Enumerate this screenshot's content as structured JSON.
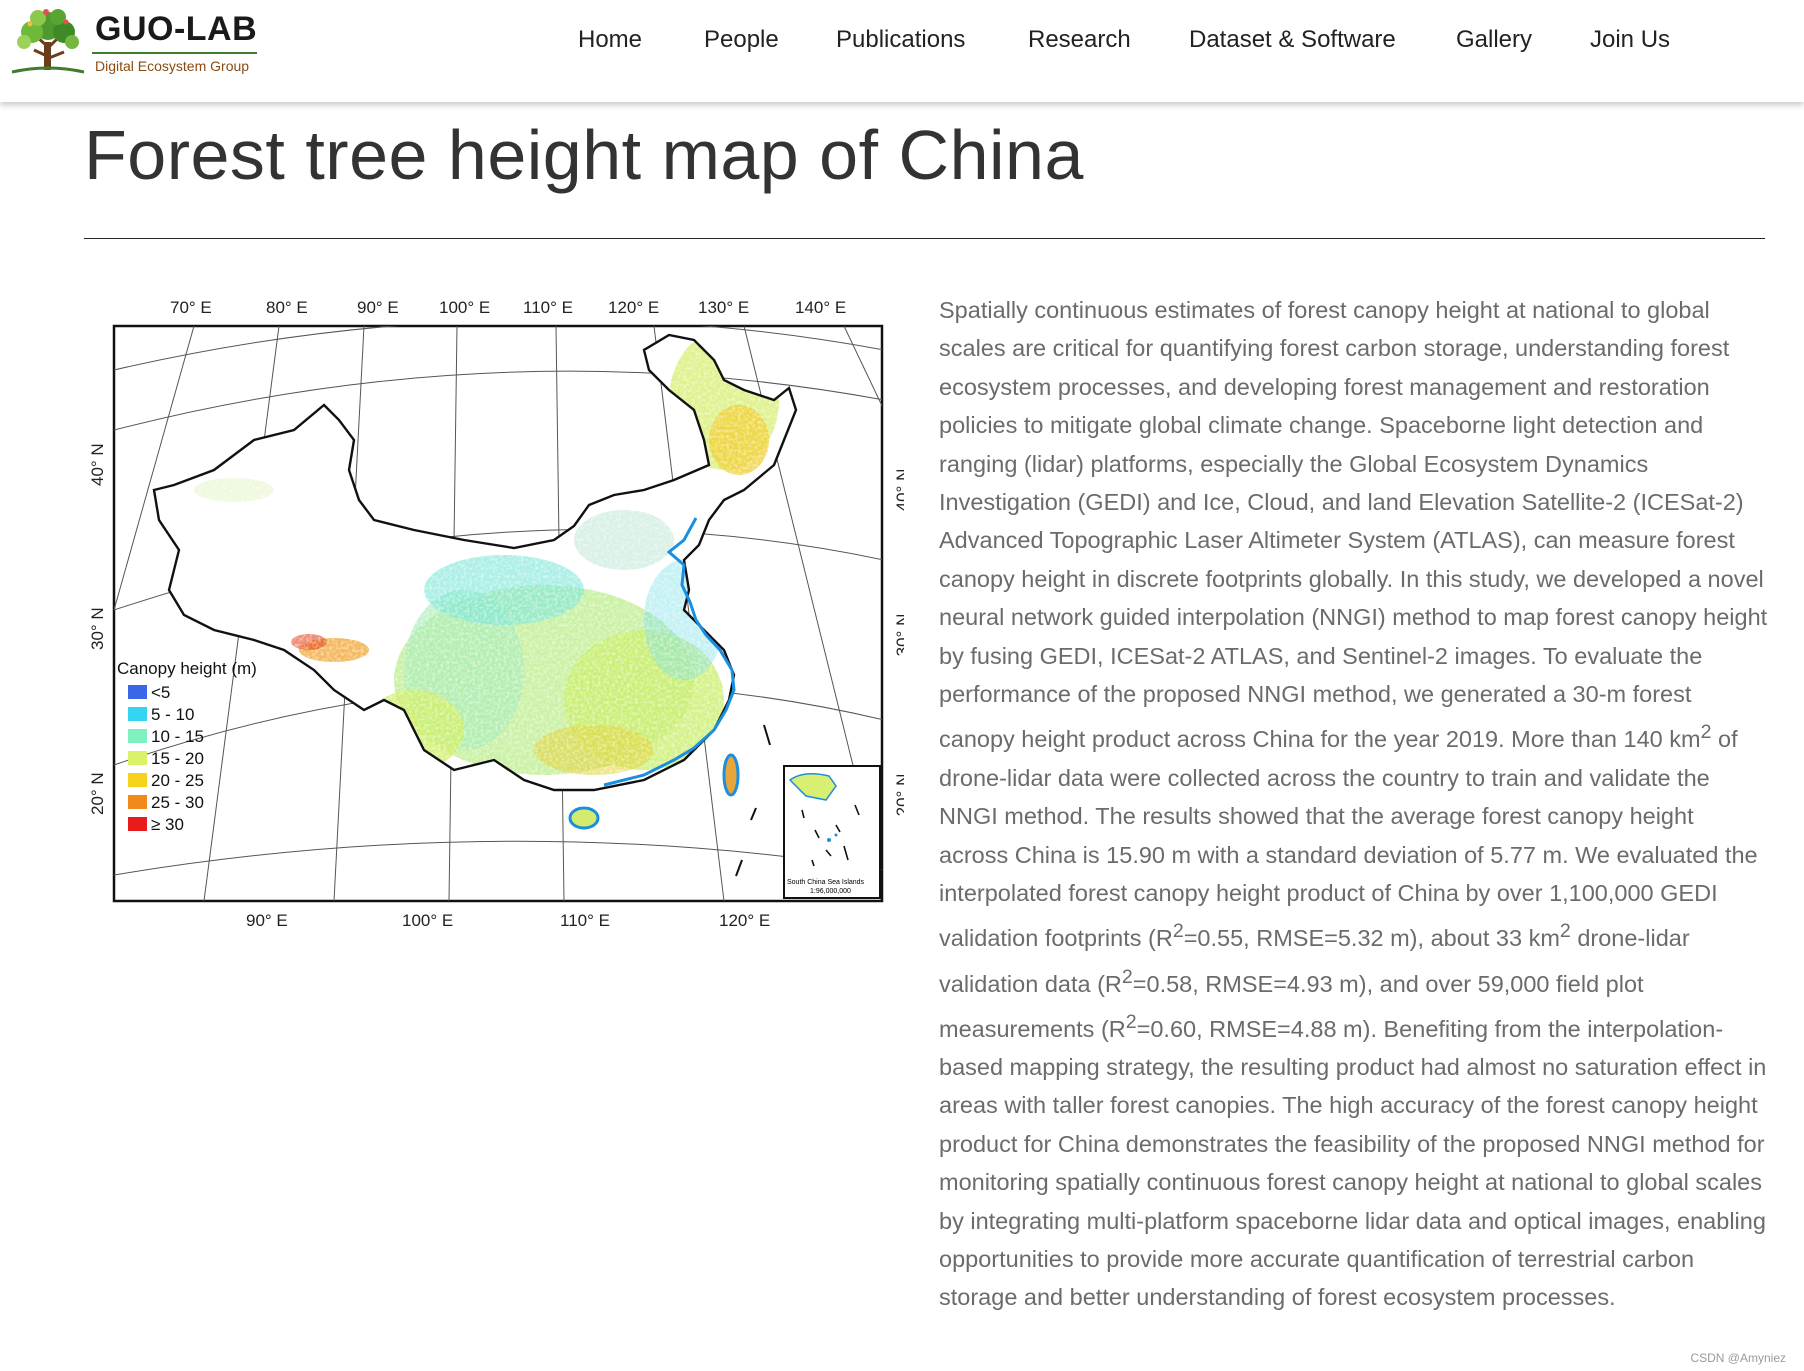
{
  "brand": {
    "name": "GUO-LAB",
    "subtitle": "Digital Ecosystem Group"
  },
  "nav": {
    "items": [
      "Home",
      "People",
      "Publications",
      "Research",
      "Dataset & Software",
      "Gallery",
      "Join Us"
    ]
  },
  "page": {
    "title": "Forest tree height map of China"
  },
  "map": {
    "top_lon_labels": [
      "70° E",
      "80° E",
      "90° E",
      "100° E",
      "110° E",
      "120° E",
      "130° E",
      "140° E"
    ],
    "bottom_lon_labels": [
      "90° E",
      "100° E",
      "110° E",
      "120° E"
    ],
    "lat_labels": [
      "40° N",
      "30° N",
      "20° N"
    ],
    "legend": {
      "title": "Canopy height (m)",
      "items": [
        {
          "label": "<5",
          "color": "#3a66e8"
        },
        {
          "label": "5 - 10",
          "color": "#35d4f2"
        },
        {
          "label": "10 - 15",
          "color": "#7ff0c0"
        },
        {
          "label": "15 - 20",
          "color": "#d8f36a"
        },
        {
          "label": "20 - 25",
          "color": "#f5d21c"
        },
        {
          "label": "25 - 30",
          "color": "#f08a1a"
        },
        {
          "label": "≥ 30",
          "color": "#e81c1c"
        }
      ]
    },
    "inset": {
      "title": "South China Sea Islands",
      "scale": "1:96,000,000"
    }
  },
  "abstract": {
    "p1": "Spatially continuous estimates of forest canopy height at national to global scales are critical for quantifying forest carbon storage, understanding forest ecosystem processes, and developing forest management and restoration policies to mitigate global climate change. Spaceborne light detection and ranging (lidar) platforms, especially the Global Ecosystem Dynamics Investigation (GEDI) and Ice, Cloud, and land Elevation Satellite-2 (ICESat-2) Advanced Topographic Laser Altimeter System (ATLAS), can measure forest canopy height in discrete footprints globally. In this study, we developed a novel neural network guided interpolation (NNGI) method to map forest canopy height by fusing GEDI, ICESat-2 ATLAS, and Sentinel-2 images. To evaluate the performance of the proposed NNGI method, we generated a 30-m forest canopy height product across China for the year 2019. More than 140 km",
    "sup1": "2",
    "p2": " of drone-lidar data were collected across the country to train and validate the NNGI method. The results showed that the average forest canopy height across China is 15.90 m with a standard deviation of 5.77 m. We evaluated the interpolated forest canopy height product of China by over 1,100,000 GEDI validation footprints (R",
    "sup2": "2",
    "p3": "=0.55, RMSE=5.32 m), about 33 km",
    "sup3": "2",
    "p4": " drone-lidar validation data (R",
    "sup4": "2",
    "p5": "=0.58, RMSE=4.93 m), and over 59,000 field plot measurements (R",
    "sup5": "2",
    "p6": "=0.60, RMSE=4.88 m). Benefiting from the interpolation-based mapping strategy, the resulting product had almost no saturation effect in areas with taller forest canopies. The high accuracy of the forest canopy height product for China demonstrates the feasibility of the proposed NNGI method for monitoring spatially continuous forest canopy height at national to global scales by integrating multi-platform spaceborne lidar data and optical images, enabling opportunities to provide more accurate quantification of terrestrial carbon storage and better understanding of forest ecosystem processes."
  },
  "watermark": "CSDN @Amyniez"
}
